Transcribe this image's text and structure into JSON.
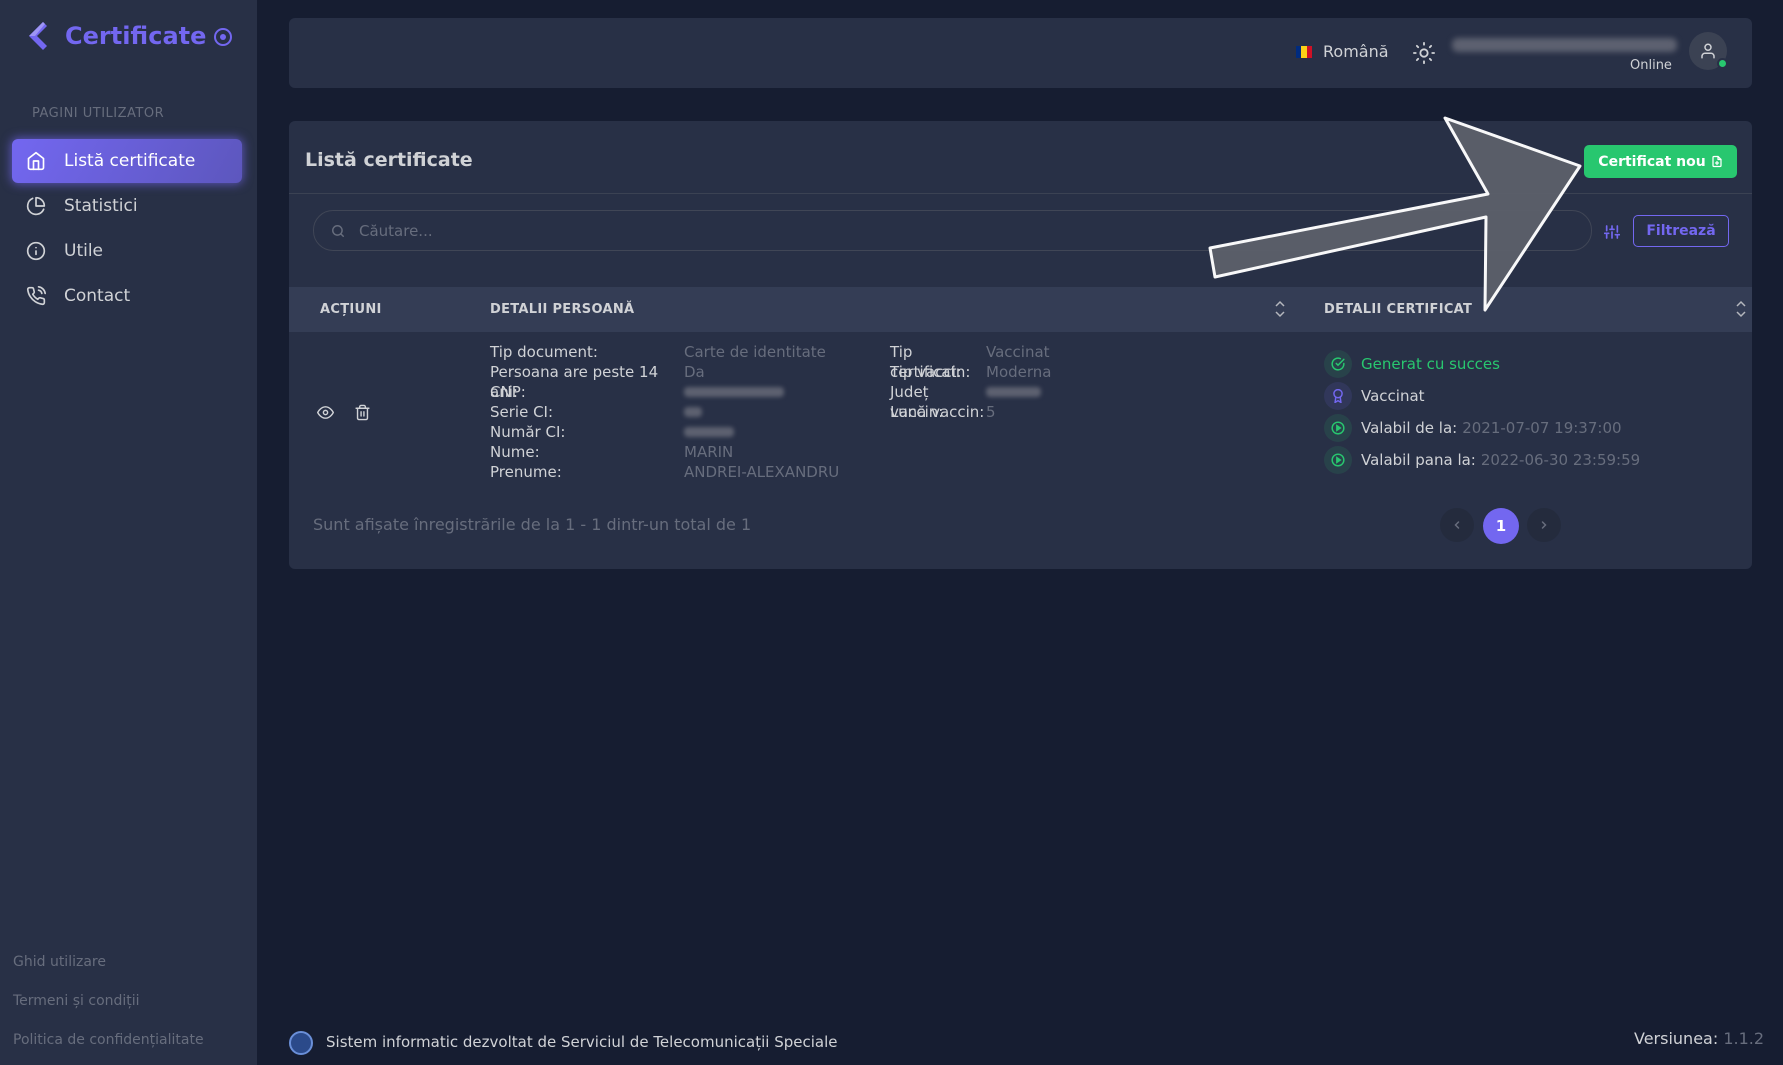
{
  "brand": {
    "name": "Certificate"
  },
  "sidebar": {
    "section_title": "PAGINI UTILIZATOR",
    "items": [
      {
        "label": "Listă certificate",
        "icon": "home-icon",
        "active": true
      },
      {
        "label": "Statistici",
        "icon": "pie-chart-icon",
        "active": false
      },
      {
        "label": "Utile",
        "icon": "info-icon",
        "active": false
      },
      {
        "label": "Contact",
        "icon": "phone-icon",
        "active": false
      }
    ],
    "footer_links": [
      "Ghid utilizare",
      "Termeni și condiții",
      "Politica de confidențialitate"
    ]
  },
  "navbar": {
    "language": "Română",
    "flag_colors": [
      "#002b7f",
      "#fcd116",
      "#ce1126"
    ],
    "user_status": "Online",
    "status_color": "#28c76f"
  },
  "card": {
    "title": "Listă certificate",
    "new_button": "Certificat nou",
    "search_placeholder": "Căutare...",
    "filter_button": "Filtrează",
    "columns": [
      "Acțiuni",
      "Detalii persoană",
      "Detalii certificat"
    ],
    "row": {
      "person": [
        {
          "label": "Tip document:",
          "value": "Carte de identitate"
        },
        {
          "label": "Persoana are peste 14 ani:",
          "value": "Da"
        },
        {
          "label": "CNP:",
          "value": ""
        },
        {
          "label": "Serie CI:",
          "value": ""
        },
        {
          "label": "Număr CI:",
          "value": ""
        },
        {
          "label": "Nume:",
          "value": "MARIN"
        },
        {
          "label": "Prenume:",
          "value": "ANDREI-ALEXANDRU"
        }
      ],
      "certificate": [
        {
          "label": "Tip certificat:",
          "value": "Vaccinat"
        },
        {
          "label": "Tip vaccin:",
          "value": "Moderna"
        },
        {
          "label": "Județ vaccin:",
          "value": ""
        },
        {
          "label": "Lună vaccin:",
          "value": "5"
        }
      ],
      "status": [
        {
          "label": "Generat cu succes",
          "value": "",
          "icon": "check-circle-icon",
          "color": "#28c76f"
        },
        {
          "label": "Vaccinat",
          "value": "",
          "icon": "award-icon",
          "color": "#7367f0"
        },
        {
          "label": "Valabil de la:",
          "value": "2021-07-07 19:37:00",
          "icon": "play-circle-icon",
          "color": "#28c76f"
        },
        {
          "label": "Valabil pana la:",
          "value": "2022-06-30 23:59:59",
          "icon": "play-circle-icon",
          "color": "#28c76f"
        }
      ]
    },
    "pagination": {
      "info": "Sunt afișate înregistrările de la 1 - 1 dintr-un total de 1",
      "current_page": "1"
    }
  },
  "footer": {
    "text": "Sistem informatic dezvoltat de Serviciul de Telecomunicații Speciale",
    "version_label": "Versiunea:",
    "version_value": "1.1.2"
  },
  "colors": {
    "accent": "#7367f0",
    "success": "#28c76f",
    "background": "#161d31",
    "card": "#283046"
  }
}
